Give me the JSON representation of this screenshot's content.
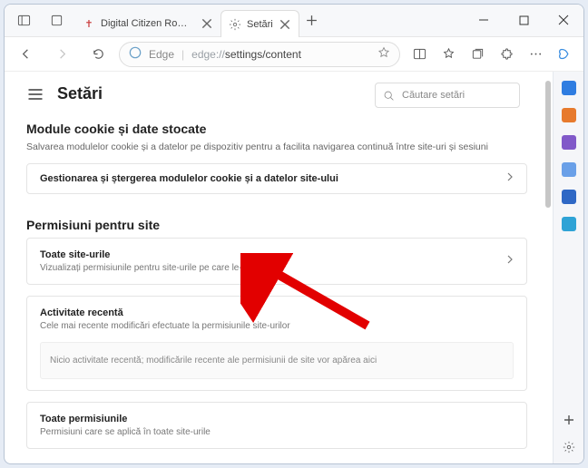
{
  "tabs": {
    "actions_icon": "tab-actions-icon",
    "inactive": {
      "title": "Digital Citizen România - Viața I…"
    },
    "active": {
      "title": "Setări"
    }
  },
  "address": {
    "prefix": "Edge",
    "url_muted": "edge://",
    "url_rest": "settings/content"
  },
  "page": {
    "title": "Setări",
    "search_placeholder": "Căutare setări"
  },
  "section_cookies": {
    "title": "Module cookie și date stocate",
    "desc": "Salvarea modulelor cookie și a datelor pe dispozitiv pentru a facilita navigarea continuă între site-uri și sesiuni",
    "manage_label": "Gestionarea și ștergerea modulelor cookie și a datelor site-ului"
  },
  "section_perms": {
    "title": "Permisiuni pentru site",
    "all_sites": {
      "title": "Toate site-urile",
      "sub": "Vizualizați permisiunile pentru site-urile pe care le-ați vizitat"
    },
    "recent": {
      "title": "Activitate recentă",
      "sub": "Cele mai recente modificări efectuate la permisiunile site-urilor",
      "empty": "Nicio activitate recentă; modificările recente ale permisiunii de site vor apărea aici"
    },
    "all_perms": {
      "title": "Toate permisiunile",
      "sub": "Permisiuni care se aplică în toate site-urile"
    }
  },
  "sidebar_colors": [
    "#2f7de1",
    "#e77a2d",
    "#8159c9",
    "#6aa0e8",
    "#2f68c5",
    "#2fa3d6"
  ]
}
